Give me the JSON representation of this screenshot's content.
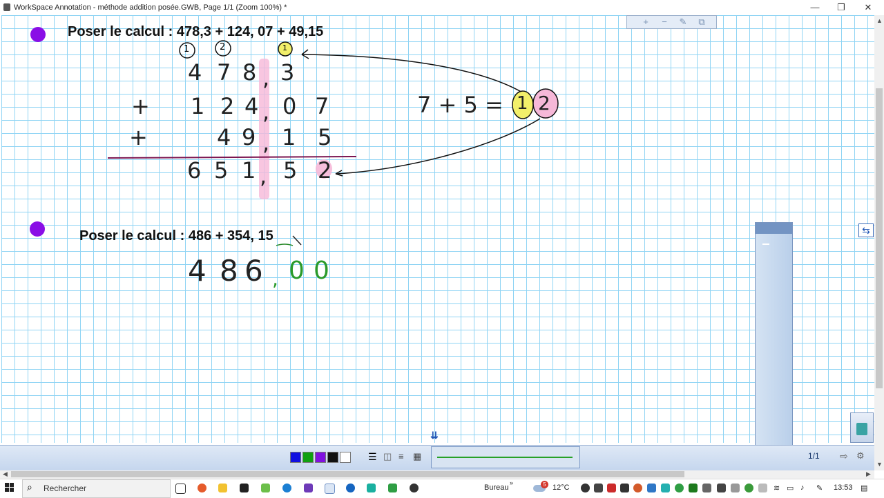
{
  "window": {
    "title": "WorkSpace Annotation - méthode addition posée.GWB, Page 1/1  (Zoom 100%) *",
    "minimize": "—",
    "maximize": "❐",
    "close": "✕"
  },
  "toolbar_top": {
    "zoom_in": "+",
    "zoom_out": "−",
    "edit": "✎",
    "copy": "⧉"
  },
  "exercise1": {
    "heading": "Poser le calcul : 478,3 + 124, 07 + 49,15",
    "col_markers": [
      "1",
      "2",
      "1"
    ],
    "row1": [
      "4",
      "7",
      "8",
      ",",
      "3"
    ],
    "row2_sign": "+",
    "row2": [
      "1",
      "2",
      "4",
      ",",
      "0",
      "7"
    ],
    "row3_sign": "+",
    "row3": [
      "4",
      "9",
      ",",
      "1",
      "5"
    ],
    "result": [
      "6",
      "5",
      "1",
      ",",
      "5",
      "2"
    ],
    "side_calc": "7 + 5 =",
    "side_result_tens": "1",
    "side_result_units": "2",
    "bullet_color": "#8a0ee6"
  },
  "exercise2": {
    "heading": "Poser le calcul : 486 + 354, 15",
    "row1_black": [
      "4",
      "8",
      "6"
    ],
    "row1_comma": ",",
    "row1_green": [
      "0",
      "0"
    ],
    "bullet_color": "#8a0ee6"
  },
  "bottom_bar": {
    "colors": [
      "#1010e0",
      "#10a010",
      "#8010e0",
      "#111111",
      "#ffffff"
    ],
    "page_indicator": "1/1",
    "line_color": "#27a127"
  },
  "taskbar": {
    "search_placeholder": "Rechercher",
    "desktop_label": "Bureau",
    "weather_badge": "5",
    "temperature": "12°C",
    "clock": "13:53"
  },
  "icons": {
    "windows": "windows-icon",
    "search": "search-icon",
    "trash": "recycle-icon"
  }
}
